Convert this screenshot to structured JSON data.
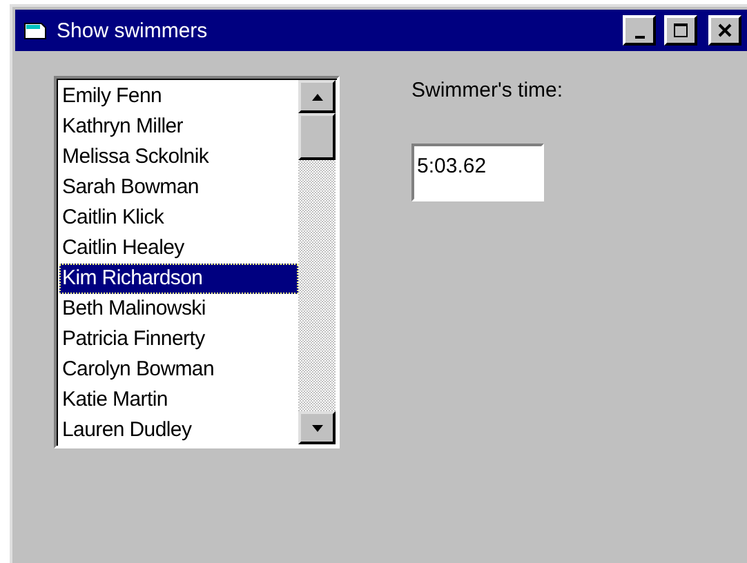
{
  "window": {
    "title": "Show swimmers"
  },
  "swimmers": [
    {
      "name": "Emily Fenn",
      "selected": false
    },
    {
      "name": "Kathryn Miller",
      "selected": false
    },
    {
      "name": "Melissa Sckolnik",
      "selected": false
    },
    {
      "name": "Sarah Bowman",
      "selected": false
    },
    {
      "name": "Caitlin Klick",
      "selected": false
    },
    {
      "name": "Caitlin Healey",
      "selected": false
    },
    {
      "name": "Kim Richardson",
      "selected": true
    },
    {
      "name": "Beth Malinowski",
      "selected": false
    },
    {
      "name": "Patricia Finnerty",
      "selected": false
    },
    {
      "name": "Carolyn Bowman",
      "selected": false
    },
    {
      "name": "Katie Martin",
      "selected": false
    },
    {
      "name": "Lauren Dudley",
      "selected": false
    }
  ],
  "time_label": "Swimmer's time:",
  "time_field": {
    "value": "5:03.62"
  }
}
